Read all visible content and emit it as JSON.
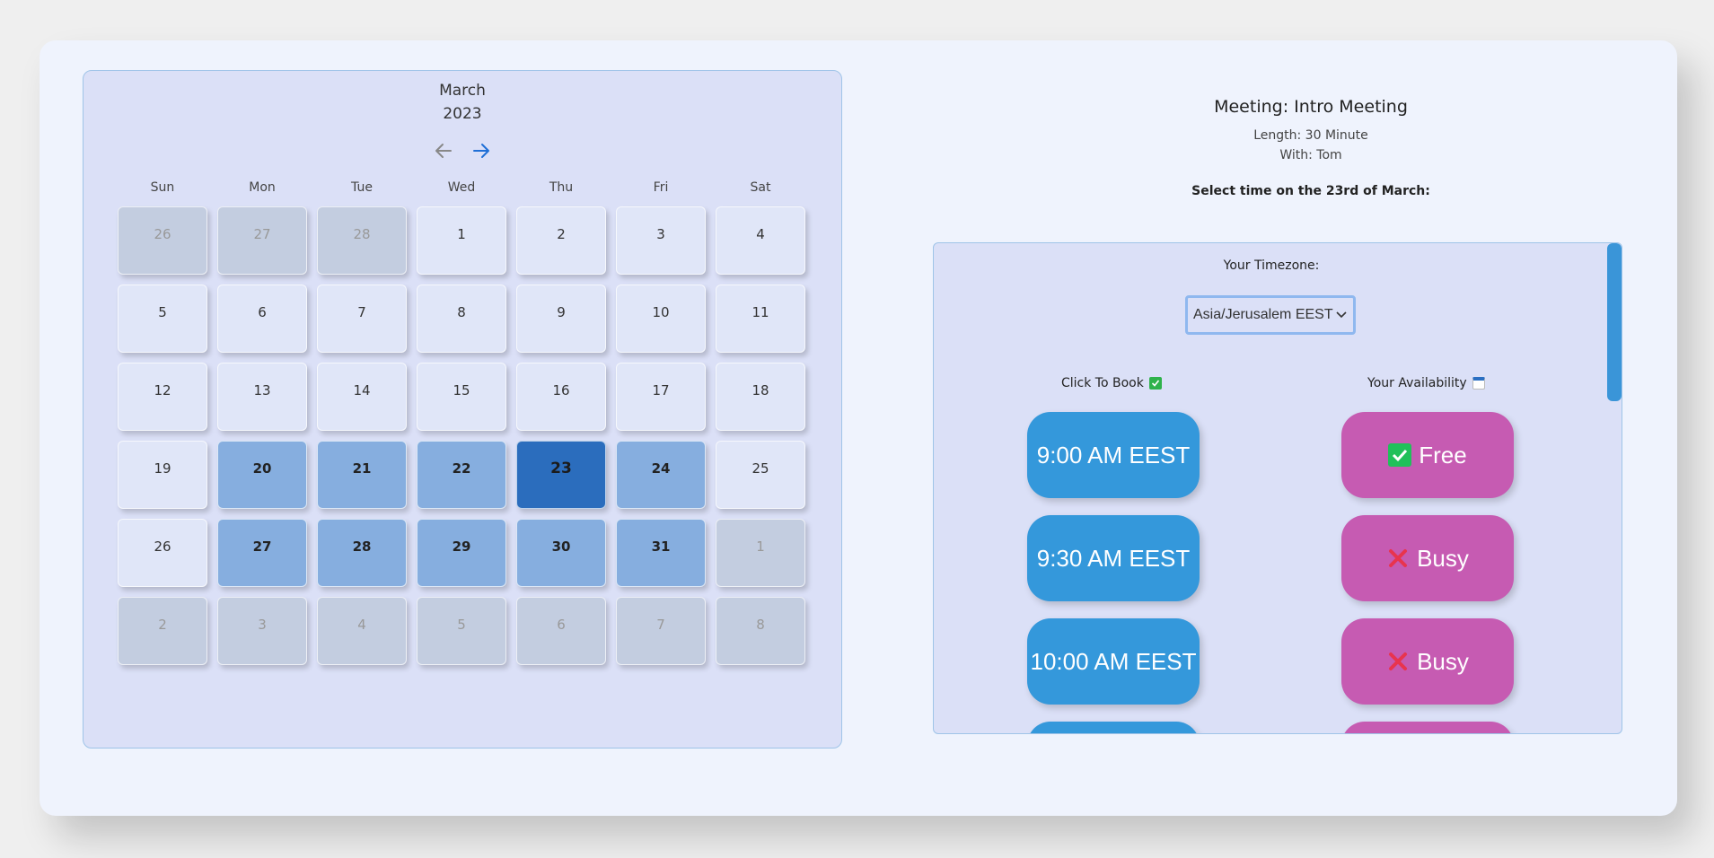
{
  "calendar": {
    "month": "March",
    "year": "2023",
    "weekdays": [
      "Sun",
      "Mon",
      "Tue",
      "Wed",
      "Thu",
      "Fri",
      "Sat"
    ],
    "days": [
      {
        "d": "26",
        "s": "outside"
      },
      {
        "d": "27",
        "s": "outside"
      },
      {
        "d": "28",
        "s": "outside"
      },
      {
        "d": "1",
        "s": "normal"
      },
      {
        "d": "2",
        "s": "normal"
      },
      {
        "d": "3",
        "s": "normal"
      },
      {
        "d": "4",
        "s": "normal"
      },
      {
        "d": "5",
        "s": "normal"
      },
      {
        "d": "6",
        "s": "normal"
      },
      {
        "d": "7",
        "s": "normal"
      },
      {
        "d": "8",
        "s": "normal"
      },
      {
        "d": "9",
        "s": "normal"
      },
      {
        "d": "10",
        "s": "normal"
      },
      {
        "d": "11",
        "s": "normal"
      },
      {
        "d": "12",
        "s": "normal"
      },
      {
        "d": "13",
        "s": "normal"
      },
      {
        "d": "14",
        "s": "normal"
      },
      {
        "d": "15",
        "s": "normal"
      },
      {
        "d": "16",
        "s": "normal"
      },
      {
        "d": "17",
        "s": "normal"
      },
      {
        "d": "18",
        "s": "normal"
      },
      {
        "d": "19",
        "s": "normal"
      },
      {
        "d": "20",
        "s": "available"
      },
      {
        "d": "21",
        "s": "available"
      },
      {
        "d": "22",
        "s": "available"
      },
      {
        "d": "23",
        "s": "selected"
      },
      {
        "d": "24",
        "s": "available"
      },
      {
        "d": "25",
        "s": "normal"
      },
      {
        "d": "26",
        "s": "normal"
      },
      {
        "d": "27",
        "s": "available"
      },
      {
        "d": "28",
        "s": "available"
      },
      {
        "d": "29",
        "s": "available"
      },
      {
        "d": "30",
        "s": "available"
      },
      {
        "d": "31",
        "s": "available"
      },
      {
        "d": "1",
        "s": "outside"
      },
      {
        "d": "2",
        "s": "outside"
      },
      {
        "d": "3",
        "s": "outside"
      },
      {
        "d": "4",
        "s": "outside"
      },
      {
        "d": "5",
        "s": "outside"
      },
      {
        "d": "6",
        "s": "outside"
      },
      {
        "d": "7",
        "s": "outside"
      },
      {
        "d": "8",
        "s": "outside"
      }
    ]
  },
  "meeting": {
    "title": "Meeting: Intro Meeting",
    "length": "Length: 30 Minute",
    "with": "With: Tom",
    "select_prompt": "Select time on the 23rd of March:"
  },
  "booking": {
    "timezone_label": "Your Timezone:",
    "timezone_value": "Asia/Jerusalem EEST",
    "col_book": "Click To Book",
    "col_avail": "Your Availability",
    "slots": [
      {
        "time": "9:00 AM EEST",
        "status": "Free",
        "status_icon": "check-icon"
      },
      {
        "time": "9:30 AM EEST",
        "status": "Busy",
        "status_icon": "cross-icon"
      },
      {
        "time": "10:00 AM EEST",
        "status": "Busy",
        "status_icon": "cross-icon"
      },
      {
        "time": "",
        "status": "",
        "status_icon": ""
      }
    ]
  },
  "colors": {
    "slot_time": "#3498db",
    "slot_status": "#c65bb2",
    "selected_day": "#2b6dbd",
    "available_day": "#86aedf"
  }
}
